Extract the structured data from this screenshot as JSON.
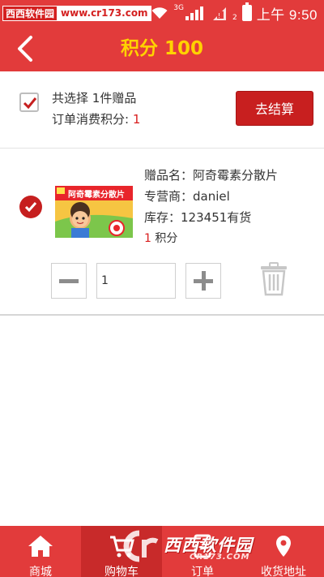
{
  "status_bar": {
    "watermark_site": "西西软件园",
    "watermark_url": "www.cr173.com",
    "network_label": "3G",
    "sim_badge": "2",
    "time": "上午 9:50"
  },
  "header": {
    "title": "积分 100"
  },
  "summary": {
    "selected_prefix": "共选择 ",
    "selected_count": "1",
    "selected_suffix": "件赠品",
    "points_label": "订单消费积分: ",
    "points_value": "1",
    "checkout_label": "去结算",
    "checked": true
  },
  "cart_items": [
    {
      "name_label": "赠品名：",
      "name": "阿奇霉素分散片",
      "vendor_label": "专营商：",
      "vendor": "daniel",
      "stock_label": "库存：",
      "stock": "123451有货",
      "points_value": "1",
      "points_unit": " 积分",
      "quantity": "1",
      "box_text": "阿奇霉素分散片",
      "checked": true
    }
  ],
  "bottom_nav": {
    "items": [
      {
        "label": "商城",
        "icon": "home-icon"
      },
      {
        "label": "购物车",
        "icon": "cart-icon",
        "active": true
      },
      {
        "label": "订单",
        "icon": "order-icon"
      },
      {
        "label": "收货地址",
        "icon": "address-icon"
      }
    ],
    "watermark_logo": "西西软件园",
    "watermark_url": "CR173.COM"
  },
  "colors": {
    "primary_red": "#e23b3b",
    "title_yellow": "#ffd200",
    "button_red": "#c81f1f"
  }
}
